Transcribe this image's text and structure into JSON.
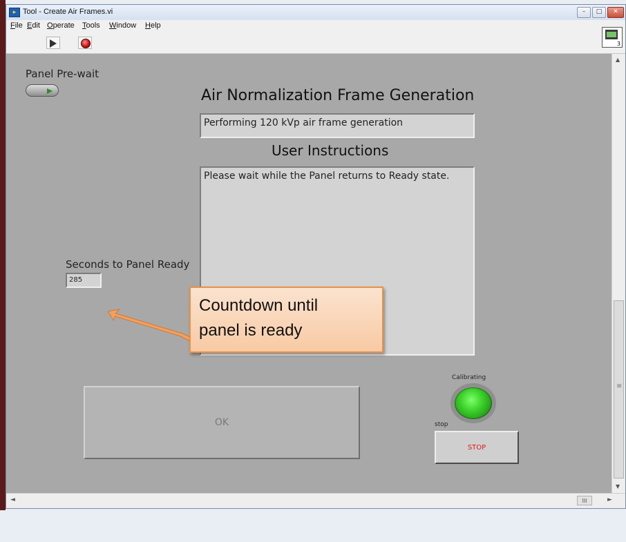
{
  "window": {
    "title": "Tool - Create Air Frames.vi",
    "controls": [
      "minimize",
      "maximize",
      "close"
    ]
  },
  "menu": [
    "File",
    "Edit",
    "Operate",
    "Tools",
    "Window",
    "Help"
  ],
  "toolbar": {
    "run_icon": "run-arrow-icon",
    "abort_icon": "abort-stop-icon",
    "vi_icon_number": "3"
  },
  "panel": {
    "pre_wait_label": "Panel Pre-wait",
    "air_norm_title": "Air Normalization Frame Generation",
    "air_norm_status": "Performing 120 kVp air frame generation",
    "user_instructions_title": "User Instructions",
    "user_instructions_text": "Please wait while the Panel returns to Ready state.",
    "seconds_label": "Seconds to Panel Ready",
    "seconds_value": "285",
    "ok_label": "OK",
    "calibrating_label": "Calibrating",
    "calibrating_led_color": "#3cd02a",
    "stop_label": "stop",
    "stop_button_label": "STOP"
  },
  "callout": {
    "line1": "Countdown until",
    "line2": "panel is ready"
  }
}
